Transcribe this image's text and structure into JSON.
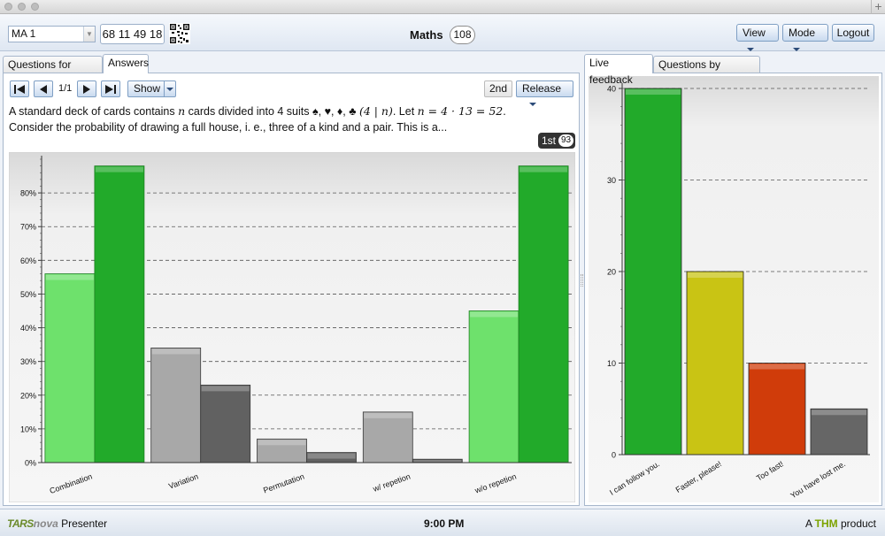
{
  "window": {
    "plus": "+"
  },
  "header": {
    "course": "MA 1",
    "session_key": "68 11 49 18",
    "title": "Maths",
    "online_count": "108",
    "view_label": "View",
    "mode_label": "Mode",
    "logout_label": "Logout"
  },
  "left_tabs": [
    {
      "label": "Questions for lecture",
      "active": false
    },
    {
      "label": "Answers",
      "active": true
    }
  ],
  "right_tabs": [
    {
      "label": "Live feedback",
      "active": true
    },
    {
      "label": "Questions by students",
      "active": false
    }
  ],
  "toolbar": {
    "pager": "1/1",
    "show_label": "Show",
    "second_label": "2nd",
    "release_label": "Release"
  },
  "question": {
    "line1_a": "A standard deck of cards contains ",
    "line1_n": "n",
    "line1_b": " cards divided into 4 suits ♠, ♥, ♦, ♣ ",
    "line1_math1": "(4 | n)",
    "line1_c": ". Let ",
    "line1_math2": "n = 4 · 13 = 52",
    "line1_d": ".",
    "line2": "Consider the probability of drawing a full house, i. e., three of a kind and a pair. This is a..."
  },
  "round_tag": {
    "label": "1st",
    "count": "93"
  },
  "footer": {
    "logo_a": "TARS",
    "logo_b": "nova",
    "app": " Presenter",
    "time": "9:00 PM",
    "product_a": "A ",
    "product_thm": "THM",
    "product_b": " product"
  },
  "colors": {
    "correct_light": "#6ee16c",
    "correct_dark": "#22aa2a",
    "wrong_light": "#a8a8a8",
    "wrong_dark": "#616161"
  },
  "chart_data": [
    {
      "type": "bar",
      "categories": [
        "Combination",
        "Variation",
        "Permutation",
        "w/ repetion",
        "w/o repetion"
      ],
      "series": [
        {
          "round": "1st",
          "values": [
            56,
            34,
            7,
            15,
            45
          ]
        },
        {
          "round": "2nd",
          "values": [
            88,
            23,
            3,
            1,
            88
          ]
        }
      ],
      "correct": [
        true,
        false,
        false,
        false,
        true
      ],
      "ylim": [
        0,
        90
      ],
      "yticks": [
        "0%",
        "10%",
        "20%",
        "30%",
        "40%",
        "50%",
        "60%",
        "70%",
        "80%"
      ],
      "grid": true
    },
    {
      "type": "bar",
      "categories": [
        "I can follow you.",
        "Faster, please!",
        "Too fast!",
        "You have lost me."
      ],
      "values": [
        40,
        20,
        10,
        5
      ],
      "colors": [
        "#22aa2a",
        "#c9c414",
        "#d03c0a",
        "#666666"
      ],
      "ylim": [
        0,
        41
      ],
      "yticks": [
        "0",
        "10",
        "20",
        "30",
        "40"
      ],
      "grid": true
    }
  ]
}
